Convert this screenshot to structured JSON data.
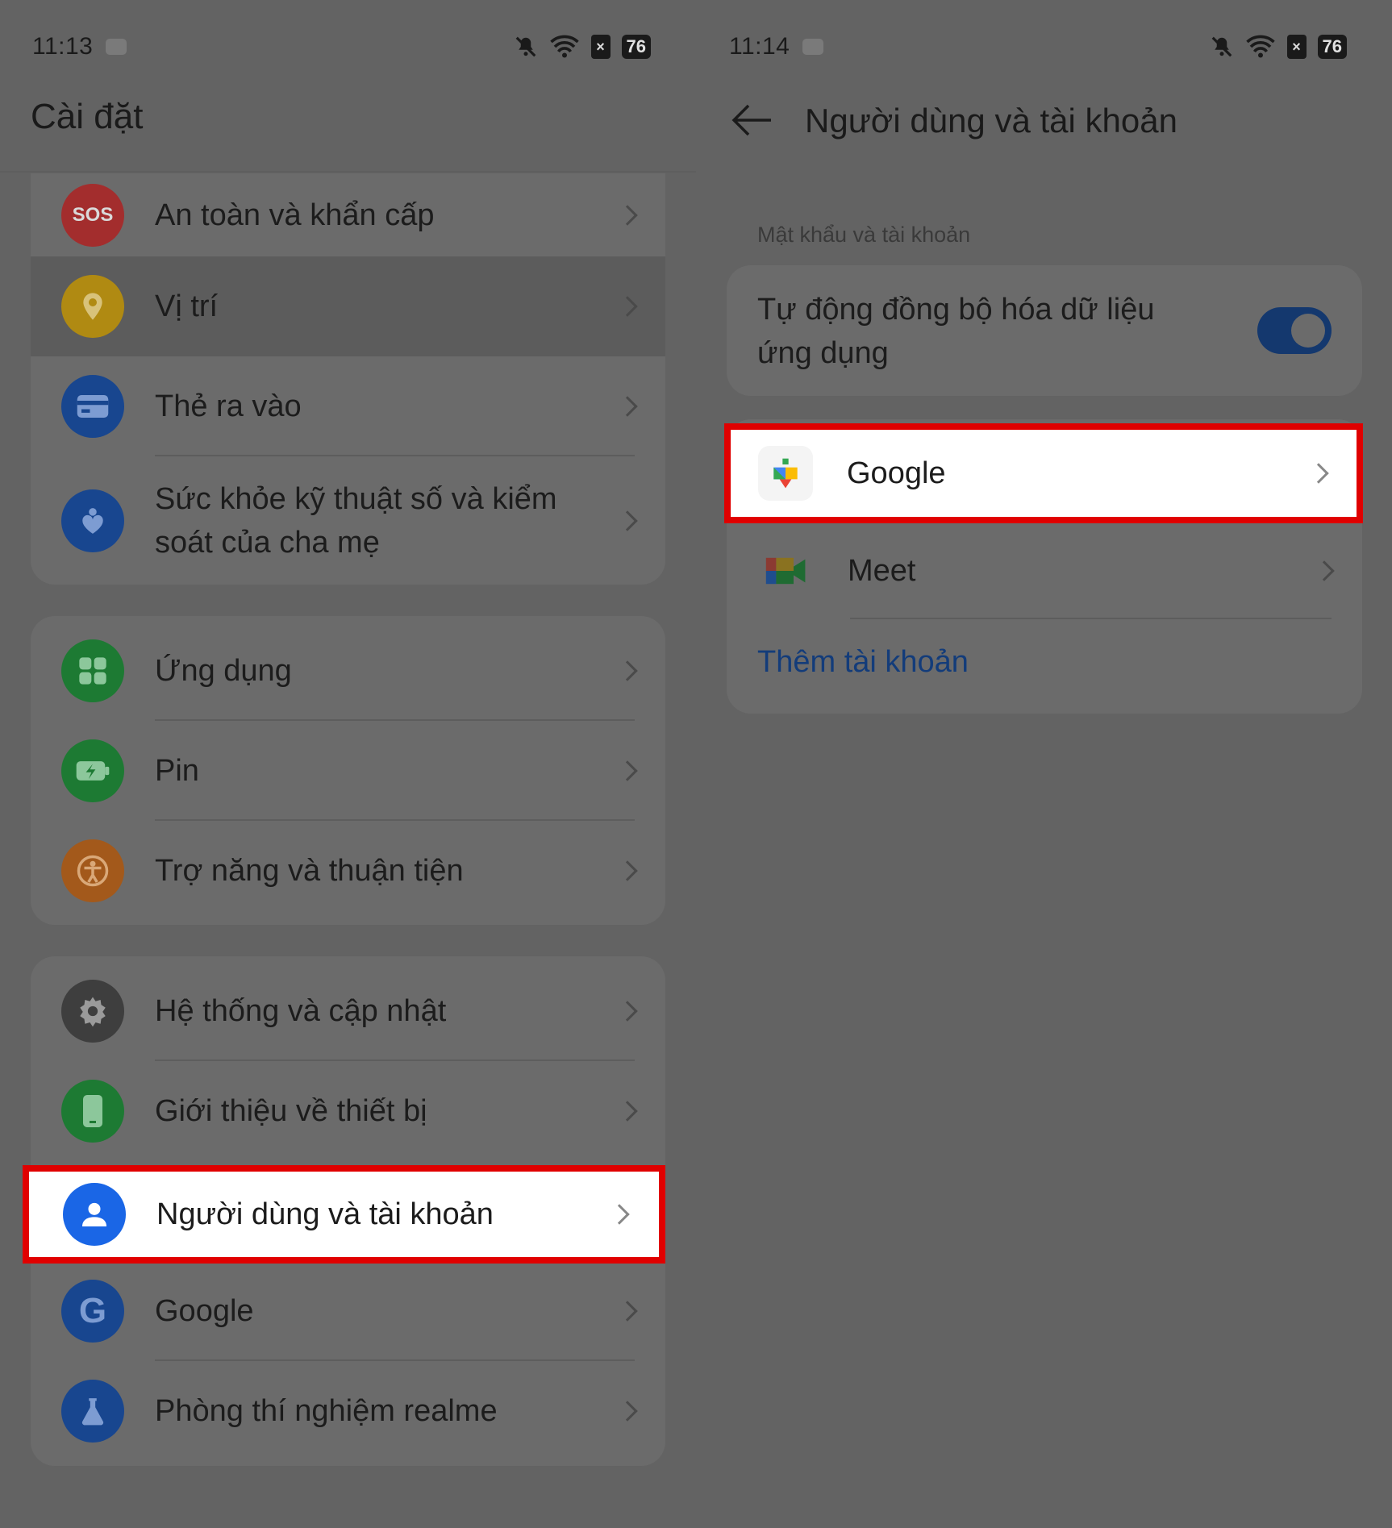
{
  "left": {
    "status": {
      "time": "11:13",
      "battery": "76"
    },
    "title": "Cài đặt",
    "group1": [
      {
        "label": "An toàn và khẩn cấp",
        "icon": "sos-icon",
        "color": "#a32d2d",
        "glyph": "SOS"
      },
      {
        "label": "Vị trí",
        "icon": "location-pin-icon",
        "color": "#b08a12",
        "glyph": ""
      },
      {
        "label": "Thẻ ra vào",
        "icon": "card-icon",
        "color": "#18468f",
        "glyph": ""
      },
      {
        "label": "Sức khỏe kỹ thuật số và kiểm soát của cha mẹ",
        "icon": "heart-person-icon",
        "color": "#18468f",
        "glyph": ""
      }
    ],
    "group2": [
      {
        "label": "Ứng dụng",
        "icon": "apps-grid-icon",
        "color": "#1d7a33",
        "glyph": ""
      },
      {
        "label": "Pin",
        "icon": "battery-icon",
        "color": "#1d7a33",
        "glyph": ""
      },
      {
        "label": "Trợ năng và thuận tiện",
        "icon": "accessibility-icon",
        "color": "#a3591b",
        "glyph": ""
      }
    ],
    "group3": [
      {
        "label": "Hệ thống và cập nhật",
        "icon": "gear-icon",
        "color": "#3e3e3e",
        "glyph": ""
      },
      {
        "label": "Giới thiệu về thiết bị",
        "icon": "phone-icon",
        "color": "#1d7a33",
        "glyph": ""
      },
      {
        "label": "Người dùng và tài khoản",
        "icon": "user-icon",
        "color": "#1a66e6",
        "glyph": ""
      },
      {
        "label": "Google",
        "icon": "google-icon",
        "color": "#18468f",
        "glyph": "G"
      },
      {
        "label": "Phòng thí nghiệm realme",
        "icon": "flask-icon",
        "color": "#18468f",
        "glyph": ""
      }
    ]
  },
  "right": {
    "status": {
      "time": "11:14",
      "battery": "76"
    },
    "title": "Người dùng và tài khoản",
    "section": "Mật khẩu và tài khoản",
    "sync": {
      "label": "Tự động đồng bộ hóa dữ liệu ứng dụng",
      "on": true
    },
    "accounts": [
      {
        "label": "Google",
        "icon": "google-play-services-icon"
      },
      {
        "label": "Meet",
        "icon": "google-meet-icon"
      }
    ],
    "add_account": "Thêm tài khoản"
  },
  "colors": {
    "highlight": "#e00000",
    "toggle": "#14386e",
    "link": "#133c7a"
  }
}
